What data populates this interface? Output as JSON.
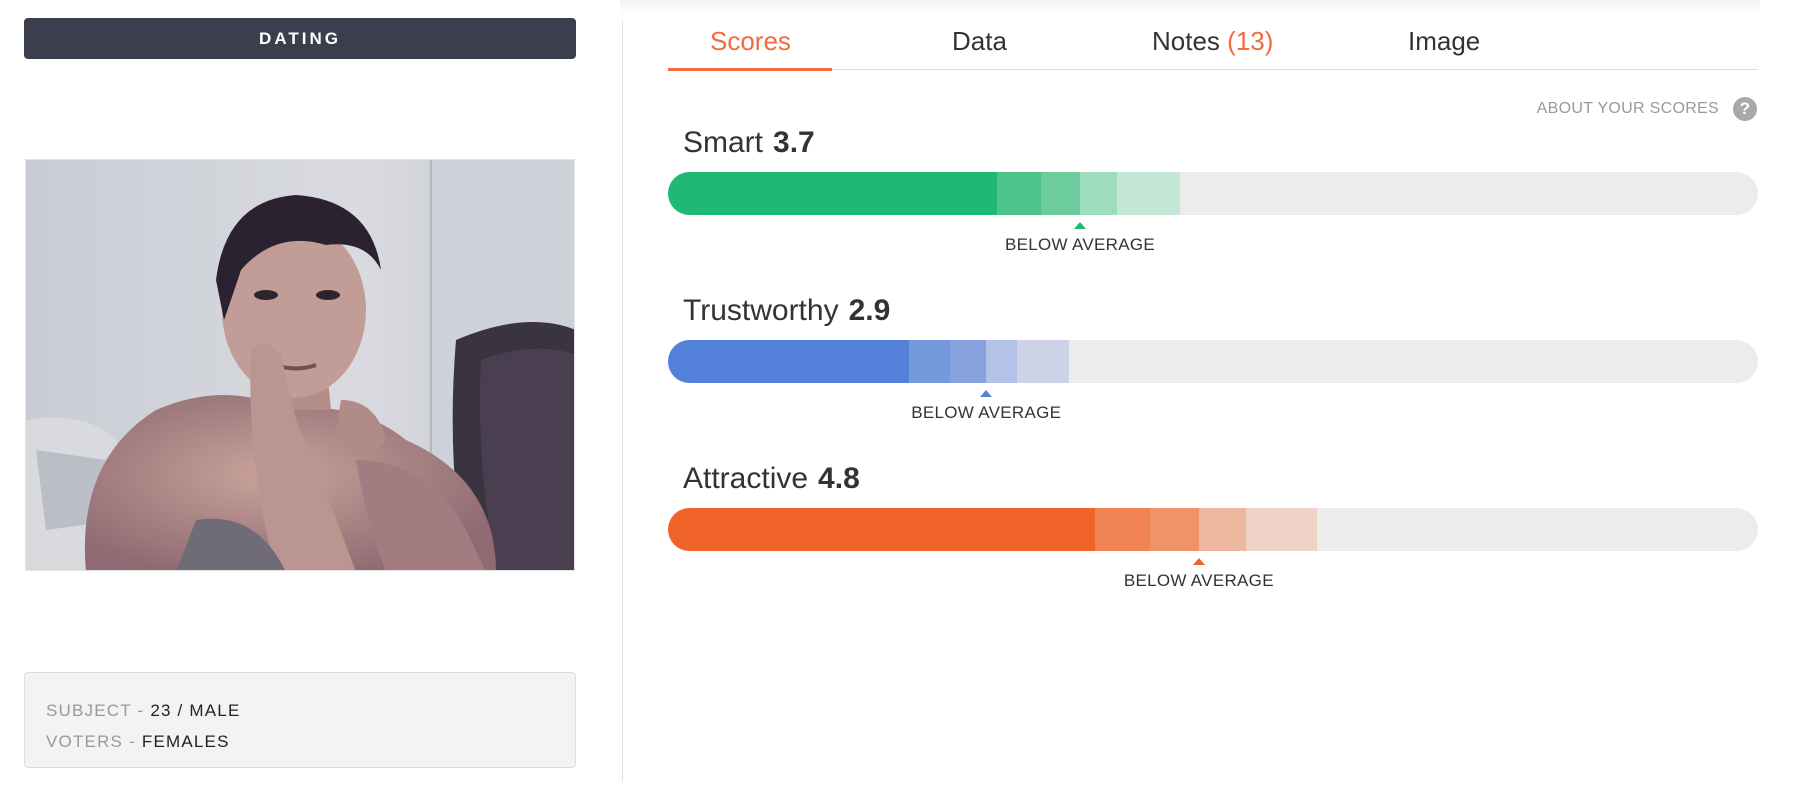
{
  "sidebar": {
    "category_label": "DATING",
    "subject_key": "SUBJECT",
    "subject_value": "23 / MALE",
    "voters_key": "VOTERS",
    "voters_value": "FEMALES",
    "separator": "-"
  },
  "tabs": [
    {
      "label": "Scores",
      "count": "",
      "active": true
    },
    {
      "label": "Data",
      "count": "",
      "active": false
    },
    {
      "label": "Notes",
      "count": "(13)",
      "active": false
    },
    {
      "label": "Image",
      "count": "",
      "active": false
    }
  ],
  "about_label": "ABOUT YOUR SCORES",
  "help_icon": "?",
  "scores": [
    {
      "label": "Smart",
      "value": "3.7",
      "rating": "BELOW AVERAGE",
      "color": "#1fb874",
      "fill_fraction": 0.302,
      "band_shades": [
        "#4cc48c",
        "#6ccc9c",
        "#9ddcbc",
        "#c4e8d6"
      ],
      "band_stops": [
        0.302,
        0.342,
        0.378,
        0.412,
        0.47
      ],
      "marker_fraction": 0.378
    },
    {
      "label": "Trustworthy",
      "value": "2.9",
      "rating": "BELOW AVERAGE",
      "color": "#5380d8",
      "fill_fraction": 0.221,
      "band_shades": [
        "#7699de",
        "#86a3e0",
        "#b3c2e6",
        "#ccd3e6"
      ],
      "band_stops": [
        0.221,
        0.259,
        0.292,
        0.32,
        0.368
      ],
      "marker_fraction": 0.292
    },
    {
      "label": "Attractive",
      "value": "4.8",
      "rating": "BELOW AVERAGE",
      "color": "#f0642a",
      "fill_fraction": 0.392,
      "band_shades": [
        "#f08454",
        "#ef9468",
        "#edb7a0",
        "#eed2c6"
      ],
      "band_stops": [
        0.392,
        0.442,
        0.487,
        0.53,
        0.595
      ],
      "marker_fraction": 0.487
    }
  ]
}
